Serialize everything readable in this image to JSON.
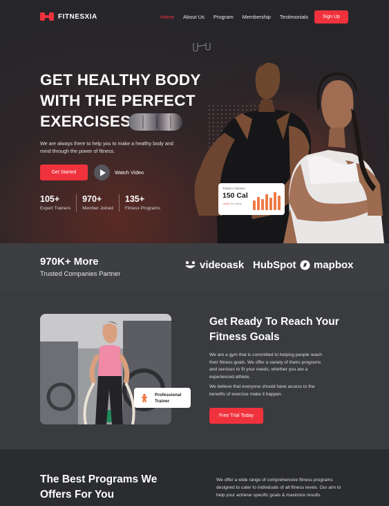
{
  "nav": {
    "brand": "FITNESXIA",
    "links": [
      "Home",
      "About Us",
      "Program",
      "Membership",
      "Testimonials"
    ],
    "active_index": 0,
    "signup_label": "Sign Up"
  },
  "hero": {
    "title_line1": "GET HEALTHY BODY",
    "title_line2": "WITH THE PERFECT",
    "title_line3": "EXERCISES",
    "subtitle": "We are always there to help you to make a healthy body and mind through the power of fitness.",
    "primary_cta": "Get Started",
    "video_cta": "Watch Video",
    "stats": [
      {
        "value": "105+",
        "label": "Expert Trainers"
      },
      {
        "value": "970+",
        "label": "Member Joined"
      },
      {
        "value": "135+",
        "label": "Fitness Programs"
      }
    ],
    "calories_card": {
      "heading": "Today's Calories",
      "value": "150 Cal",
      "change": "+4.6%",
      "change_suffix": "This Week",
      "bars": [
        0.55,
        0.75,
        0.6,
        0.9,
        0.7,
        1.0,
        0.8
      ]
    }
  },
  "trusted": {
    "title": "970K+ More",
    "subtitle": "Trusted Companies Partner",
    "partners": [
      "videoask",
      "HubSpot",
      "mapbox"
    ]
  },
  "about": {
    "title": "Get Ready To Reach Your Fitness Goals",
    "paragraph1": "We are a gym that is committed to helping people reach their fitness goals. We offer a variety of theirs programs and services to fit your needs, whether you are a experienced athlete.",
    "paragraph2": "We believe that everyone should have access to the benefits of exercise make it happen.",
    "cta": "Free Trial Today",
    "trainer_badge": "Professional Trainer"
  },
  "programs": {
    "title": "The Best Programs We Offers For You",
    "description": "We offer a wide range of comprehensive fitness programs designed to cater to individuals of all fitness levels. Our aim to help your achieve specific goals & maximize results."
  },
  "colors": {
    "accent": "#f0323d",
    "dark_bg": "#26262a",
    "section_bg": "#3a3b3f",
    "footer_bg": "#2b2c30",
    "chart_bar": "#f07a45"
  }
}
